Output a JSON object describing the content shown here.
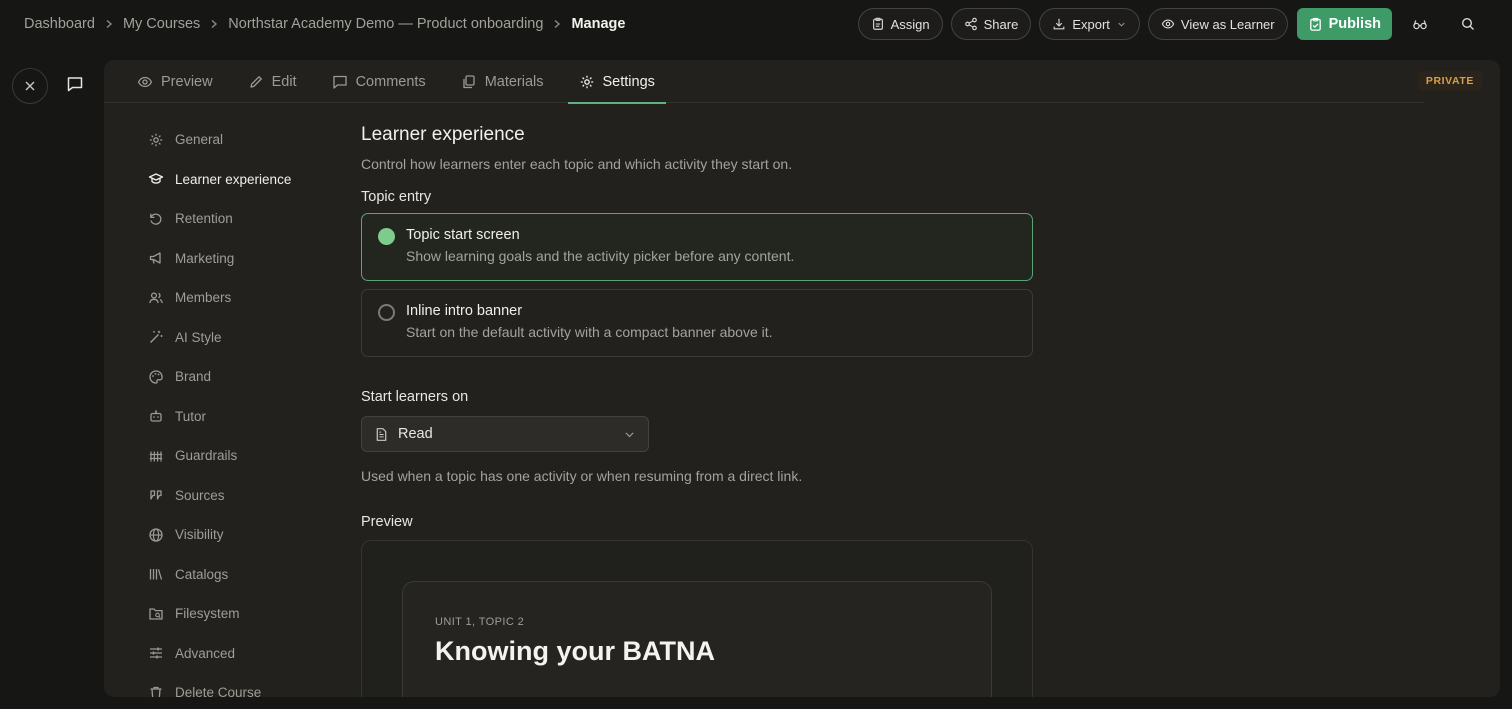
{
  "breadcrumb": {
    "items": [
      "Dashboard",
      "My Courses",
      "Northstar Academy Demo — Product onboarding"
    ],
    "current": "Manage"
  },
  "header": {
    "assign": "Assign",
    "share": "Share",
    "export": "Export",
    "view_as_learner": "View as Learner",
    "publish": "Publish"
  },
  "tabs": [
    "Preview",
    "Edit",
    "Comments",
    "Materials",
    "Settings"
  ],
  "visibility_badge": "PRIVATE",
  "settings_nav": [
    "General",
    "Learner experience",
    "Retention",
    "Marketing",
    "Members",
    "AI Style",
    "Brand",
    "Tutor",
    "Guardrails",
    "Sources",
    "Visibility",
    "Catalogs",
    "Filesystem",
    "Advanced",
    "Delete Course"
  ],
  "content": {
    "title": "Learner experience",
    "subtitle": "Control how learners enter each topic and which activity they start on.",
    "topic_entry_label": "Topic entry",
    "options": [
      {
        "title": "Topic start screen",
        "desc": "Show learning goals and the activity picker before any content."
      },
      {
        "title": "Inline intro banner",
        "desc": "Start on the default activity with a compact banner above it."
      }
    ],
    "start_label": "Start learners on",
    "start_value": "Read",
    "help": "Used when a topic has one activity or when resuming from a direct link.",
    "preview_label": "Preview",
    "preview_eyebrow": "UNIT 1, TOPIC 2",
    "preview_title": "Knowing your BATNA"
  },
  "colors": {
    "accent": "#3e9a66",
    "selected_border": "#5ba477",
    "badge": "#d8a04a"
  }
}
